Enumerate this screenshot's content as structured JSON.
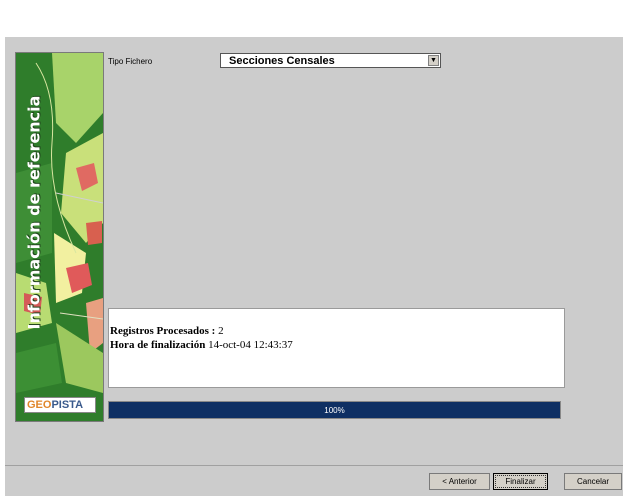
{
  "sidebar": {
    "title": "Información de referencia",
    "logo_geo": "GEO",
    "logo_pista": "PISTA"
  },
  "form": {
    "tipo_label": "Tipo Fichero",
    "tipo_value": "Secciones Censales"
  },
  "log": {
    "line1_label": "Registros Procesados :",
    "line1_value": "2",
    "line2_label": "Hora de finalización",
    "line2_value": "14-oct-04 12:43:37"
  },
  "progress": {
    "value": 1.0,
    "label": "100%",
    "color": "#0e2f63"
  },
  "buttons": {
    "back": "< Anterior",
    "finish": "Finalizar",
    "cancel": "Cancelar"
  }
}
